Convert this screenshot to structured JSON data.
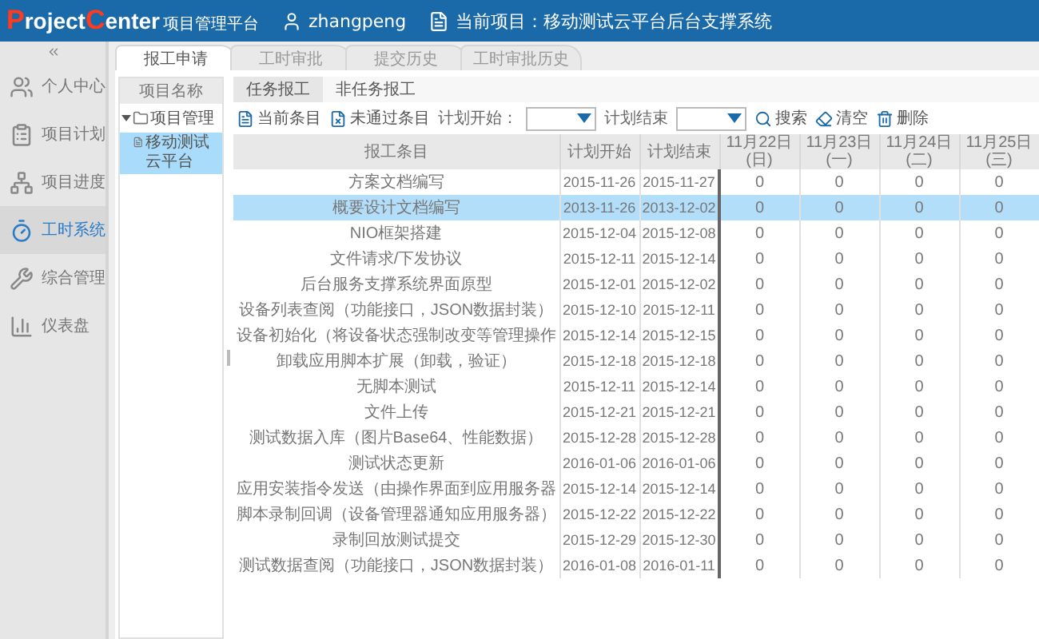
{
  "header": {
    "logo": [
      {
        "text": "P",
        "accent": true
      },
      {
        "text": "roject",
        "accent": false
      },
      {
        "text": "C",
        "accent": true
      },
      {
        "text": "enter",
        "accent": false
      }
    ],
    "platform": "项目管理平台",
    "user": "zhangpeng",
    "current_project": "当前项目：移动测试云平台后台支撑系统"
  },
  "sidebar": {
    "items": [
      {
        "label": "个人中心",
        "kind": "users",
        "selected": false
      },
      {
        "label": "项目计划",
        "kind": "plan",
        "selected": false
      },
      {
        "label": "项目进度",
        "kind": "progress",
        "selected": false
      },
      {
        "label": "工时系统",
        "kind": "timer",
        "selected": true
      },
      {
        "label": "综合管理",
        "kind": "tools",
        "selected": false
      },
      {
        "label": "仪表盘",
        "kind": "chart",
        "selected": false
      }
    ]
  },
  "tabs": [
    {
      "label": "报工申请",
      "selected": true
    },
    {
      "label": "工时审批",
      "selected": false
    },
    {
      "label": "提交历史",
      "selected": false
    },
    {
      "label": "工时审批历史",
      "selected": false
    }
  ],
  "tree": {
    "heading": "项目名称",
    "nodes": [
      {
        "label": "项目管理",
        "expanded": true,
        "children": [
          {
            "label": "移动测试云平台",
            "selected": true
          }
        ]
      }
    ]
  },
  "subtabs": [
    {
      "label": "任务报工",
      "selected": true
    },
    {
      "label": "非任务报工",
      "selected": false
    }
  ],
  "toolbar": {
    "current": "当前条目",
    "rejected": "未通过条目",
    "start_label": "计划开始：",
    "end_label": "计划结束",
    "search": "搜索",
    "clear": "清空",
    "delete": "删除"
  },
  "table": {
    "columns": [
      "报工条目",
      "计划开始",
      "计划结束",
      "11月22日(日)",
      "11月23日(一)",
      "11月24日(二)",
      "11月25日(三)"
    ],
    "rows": [
      {
        "cells": [
          "方案文档编写",
          "2015-11-26",
          "2015-11-27",
          "0",
          "0",
          "0",
          "0"
        ],
        "selected": false
      },
      {
        "cells": [
          "概要设计文档编写",
          "2013-11-26",
          "2013-12-02",
          "0",
          "0",
          "0",
          "0"
        ],
        "selected": true
      },
      {
        "cells": [
          "NIO框架搭建",
          "2015-12-04",
          "2015-12-08",
          "0",
          "0",
          "0",
          "0"
        ],
        "selected": false
      },
      {
        "cells": [
          "文件请求/下发协议",
          "2015-12-11",
          "2015-12-14",
          "0",
          "0",
          "0",
          "0"
        ],
        "selected": false
      },
      {
        "cells": [
          "后台服务支撑系统界面原型",
          "2015-12-01",
          "2015-12-02",
          "0",
          "0",
          "0",
          "0"
        ],
        "selected": false
      },
      {
        "cells": [
          "设备列表查阅（功能接口，JSON数据封装）",
          "2015-12-10",
          "2015-12-11",
          "0",
          "0",
          "0",
          "0"
        ],
        "selected": false
      },
      {
        "cells": [
          "设备初始化（将设备状态强制改变等管理操作",
          "2015-12-14",
          "2015-12-15",
          "0",
          "0",
          "0",
          "0"
        ],
        "selected": false
      },
      {
        "cells": [
          "卸载应用脚本扩展（卸载，验证）",
          "2015-12-18",
          "2015-12-18",
          "0",
          "0",
          "0",
          "0"
        ],
        "selected": false
      },
      {
        "cells": [
          "无脚本测试",
          "2015-12-11",
          "2015-12-14",
          "0",
          "0",
          "0",
          "0"
        ],
        "selected": false
      },
      {
        "cells": [
          "文件上传",
          "2015-12-21",
          "2015-12-21",
          "0",
          "0",
          "0",
          "0"
        ],
        "selected": false
      },
      {
        "cells": [
          "测试数据入库（图片Base64、性能数据）",
          "2015-12-28",
          "2015-12-28",
          "0",
          "0",
          "0",
          "0"
        ],
        "selected": false
      },
      {
        "cells": [
          "测试状态更新",
          "2016-01-06",
          "2016-01-06",
          "0",
          "0",
          "0",
          "0"
        ],
        "selected": false
      },
      {
        "cells": [
          "应用安装指令发送（由操作界面到应用服务器",
          "2015-12-14",
          "2015-12-14",
          "0",
          "0",
          "0",
          "0"
        ],
        "selected": false
      },
      {
        "cells": [
          "脚本录制回调（设备管理器通知应用服务器）",
          "2015-12-22",
          "2015-12-22",
          "0",
          "0",
          "0",
          "0"
        ],
        "selected": false
      },
      {
        "cells": [
          "录制回放测试提交",
          "2015-12-29",
          "2015-12-30",
          "0",
          "0",
          "0",
          "0"
        ],
        "selected": false
      },
      {
        "cells": [
          "测试数据查阅（功能接口，JSON数据封装）",
          "2016-01-08",
          "2016-01-11",
          "0",
          "0",
          "0",
          "0"
        ],
        "selected": false
      }
    ]
  }
}
